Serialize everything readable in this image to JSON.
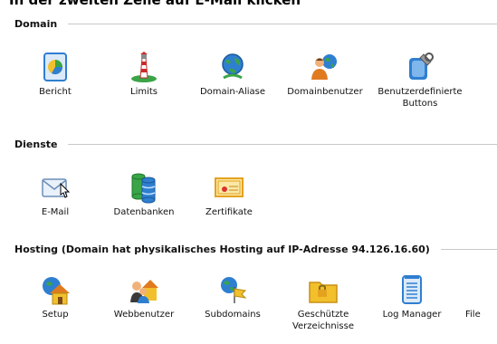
{
  "caption": "In der zweiten Zeile auf E-Mail klicken",
  "sections": {
    "domain": {
      "title": "Domain",
      "items": [
        {
          "label": "Bericht",
          "icon": "report-icon"
        },
        {
          "label": "Limits",
          "icon": "limits-lighthouse-icon"
        },
        {
          "label": "Domain-Aliase",
          "icon": "domain-alias-icon"
        },
        {
          "label": "Domainbenutzer",
          "icon": "domain-user-icon"
        },
        {
          "label": "Benutzerdefinierte Buttons",
          "icon": "custom-buttons-icon"
        }
      ]
    },
    "services": {
      "title": "Dienste",
      "items": [
        {
          "label": "E-Mail",
          "icon": "email-envelope-icon"
        },
        {
          "label": "Datenbanken",
          "icon": "database-icon"
        },
        {
          "label": "Zertifikate",
          "icon": "certificate-icon"
        }
      ]
    },
    "hosting": {
      "title": "Hosting (Domain hat physikalisches Hosting auf IP-Adresse 94.126.16.60)",
      "items": [
        {
          "label": "Setup",
          "icon": "setup-house-icon"
        },
        {
          "label": "Webbenutzer",
          "icon": "web-users-icon"
        },
        {
          "label": "Subdomains",
          "icon": "subdomains-icon"
        },
        {
          "label": "Geschützte Verzeichnisse",
          "icon": "protected-directories-icon"
        },
        {
          "label": "Log Manager",
          "icon": "log-manager-icon"
        },
        {
          "label": "File",
          "icon": "file-manager-icon"
        }
      ]
    }
  },
  "colors": {
    "rule": "#c9c9c9",
    "icon_blue": "#2f7fd0",
    "icon_green": "#3aa447",
    "icon_yellow": "#f2c02c"
  }
}
